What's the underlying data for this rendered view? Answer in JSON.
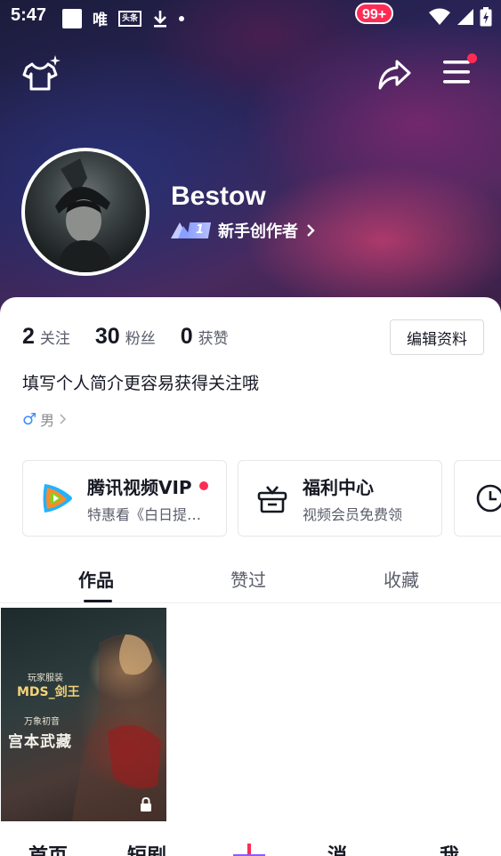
{
  "status_bar": {
    "time": "5:47",
    "left_icons": [
      "white-square",
      "唯",
      "头条",
      "download",
      "dot"
    ],
    "right_icons": [
      "wifi",
      "signal",
      "battery-charging"
    ]
  },
  "profile": {
    "username": "Bestow",
    "level": "1",
    "level_title": "新手创作者",
    "stats": [
      {
        "num": "2",
        "label": "关注"
      },
      {
        "num": "30",
        "label": "粉丝"
      },
      {
        "num": "0",
        "label": "获赞"
      }
    ],
    "edit_label": "编辑资料",
    "bio": "填写个人简介更容易获得关注哦",
    "gender": "男"
  },
  "topbar": {
    "menu_has_notification": true,
    "colors": {
      "accent": "#fe2c55",
      "level_badge": "#8aa0ff",
      "gender": "#3a8bff"
    }
  },
  "services": {
    "vip": {
      "title": "腾讯视频VIP",
      "sub": "特惠看《白日提…"
    },
    "welfare": {
      "title": "福利中心",
      "sub": "视频会员免费领"
    }
  },
  "tabs": {
    "works": "作品",
    "liked": "赞过",
    "favorites": "收藏",
    "active": "works"
  },
  "works": [
    {
      "line1": "玩家服装",
      "line2": "MDS_剑王",
      "line3": "万象初音",
      "line4": "宫本武藏",
      "locked": true
    }
  ],
  "bottom_nav": {
    "home": "首页",
    "drama": "短剧",
    "messages": "消",
    "me": "我",
    "message_badge": "99+"
  }
}
